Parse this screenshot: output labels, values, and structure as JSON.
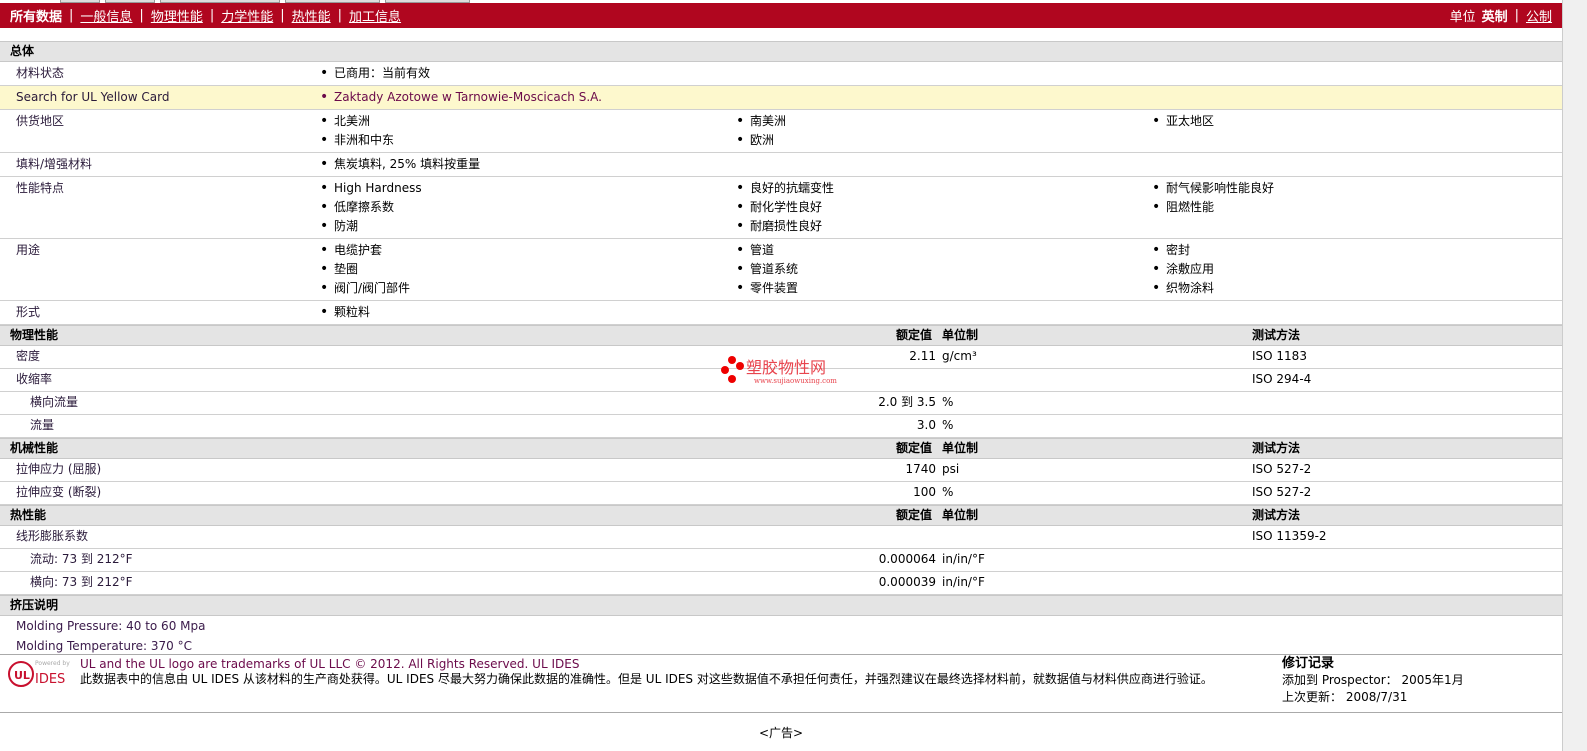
{
  "nav": {
    "items": [
      "所有数据",
      "一般信息",
      "物理性能",
      "力学性能",
      "热性能",
      "加工信息"
    ],
    "units_label": "单位",
    "unit_english": "英制",
    "unit_metric": "公制"
  },
  "general": {
    "title": "总体",
    "rows": [
      {
        "label": "材料状态",
        "cols": [
          [
            "已商用：当前有效"
          ]
        ]
      },
      {
        "label": "Search for UL Yellow Card",
        "cols": [
          [
            "Zaktady Azotowe w Tarnowie-Moscicach S.A."
          ]
        ],
        "highlight": true
      },
      {
        "label": "供货地区",
        "cols": [
          [
            "北美洲",
            "非洲和中东"
          ],
          [
            "南美洲",
            "欧洲"
          ],
          [
            "亚太地区"
          ]
        ]
      },
      {
        "label": "填料/增强材料",
        "cols": [
          [
            "焦炭填料, 25% 填料按重量"
          ]
        ]
      },
      {
        "label": "性能特点",
        "cols": [
          [
            "High Hardness",
            "低摩擦系数",
            "防潮"
          ],
          [
            "良好的抗蠕变性",
            "耐化学性良好",
            "耐磨损性良好"
          ],
          [
            "耐气候影响性能良好",
            "阻燃性能"
          ]
        ]
      },
      {
        "label": "用途",
        "cols": [
          [
            "电缆护套",
            "垫圈",
            "阀门/阀门部件"
          ],
          [
            "管道",
            "管道系统",
            "零件装置"
          ],
          [
            "密封",
            "涂敷应用",
            "织物涂料"
          ]
        ]
      },
      {
        "label": "形式",
        "cols": [
          [
            "颗粒料"
          ]
        ]
      }
    ]
  },
  "headers": {
    "value": "额定值",
    "unit": "单位制",
    "test": "测试方法"
  },
  "sections": [
    {
      "title": "物理性能",
      "rows": [
        {
          "label": "密度",
          "value": "2.11",
          "unit": "g/cm³",
          "test": "ISO 1183"
        },
        {
          "label": "收缩率",
          "value": "",
          "unit": "",
          "test": "ISO 294-4"
        },
        {
          "label": "横向流量",
          "value": "2.0 到  3.5",
          "unit": "%",
          "test": "",
          "indent": true
        },
        {
          "label": "流量",
          "value": "3.0",
          "unit": "%",
          "test": "",
          "indent": true
        }
      ]
    },
    {
      "title": "机械性能",
      "rows": [
        {
          "label": "拉伸应力 (屈服)",
          "value": "1740",
          "unit": "psi",
          "test": "ISO 527-2"
        },
        {
          "label": "拉伸应变 (断裂)",
          "value": "100",
          "unit": "%",
          "test": "ISO 527-2"
        }
      ]
    },
    {
      "title": "热性能",
      "rows": [
        {
          "label": "线形膨胀系数",
          "value": "",
          "unit": "",
          "test": "ISO 11359-2"
        },
        {
          "label": "流动: 73 到  212°F",
          "value": "0.000064",
          "unit": "in/in/°F",
          "test": "",
          "indent": true
        },
        {
          "label": "横向: 73 到  212°F",
          "value": "0.000039",
          "unit": "in/in/°F",
          "test": "",
          "indent": true
        }
      ]
    }
  ],
  "extrusion": {
    "title": "挤压说明",
    "notes": [
      "Molding Pressure: 40 to 60 Mpa",
      "Molding Temperature: 370 °C"
    ]
  },
  "watermark": {
    "name": "塑胶物性网",
    "url": "www.sujiaowuxing.com"
  },
  "footer": {
    "logo_powered": "Powered by",
    "logo_brand": "IDES",
    "logo_ul": "UL",
    "line1": "UL and the UL logo are trademarks of UL LLC © 2012. All Rights Reserved. UL IDES",
    "line2": "此数据表中的信息由  UL IDES 从该材料的生产商处获得。UL IDES 尽最大努力确保此数据的准确性。但是  UL IDES 对这些数据值不承担任何责任，并强烈建议在最终选择材料前，就数据值与材料供应商进行验证。",
    "rev_title": "修订记录",
    "added_label": "添加到  Prospector：",
    "added_value": "2005年1月",
    "updated_label": "上次更新：",
    "updated_value": "2008/7/31"
  },
  "ad": "<广告>",
  "colors": {
    "nav": "#b0061f",
    "section": "#e4e4e4",
    "highlight": "#fdf8cd"
  }
}
